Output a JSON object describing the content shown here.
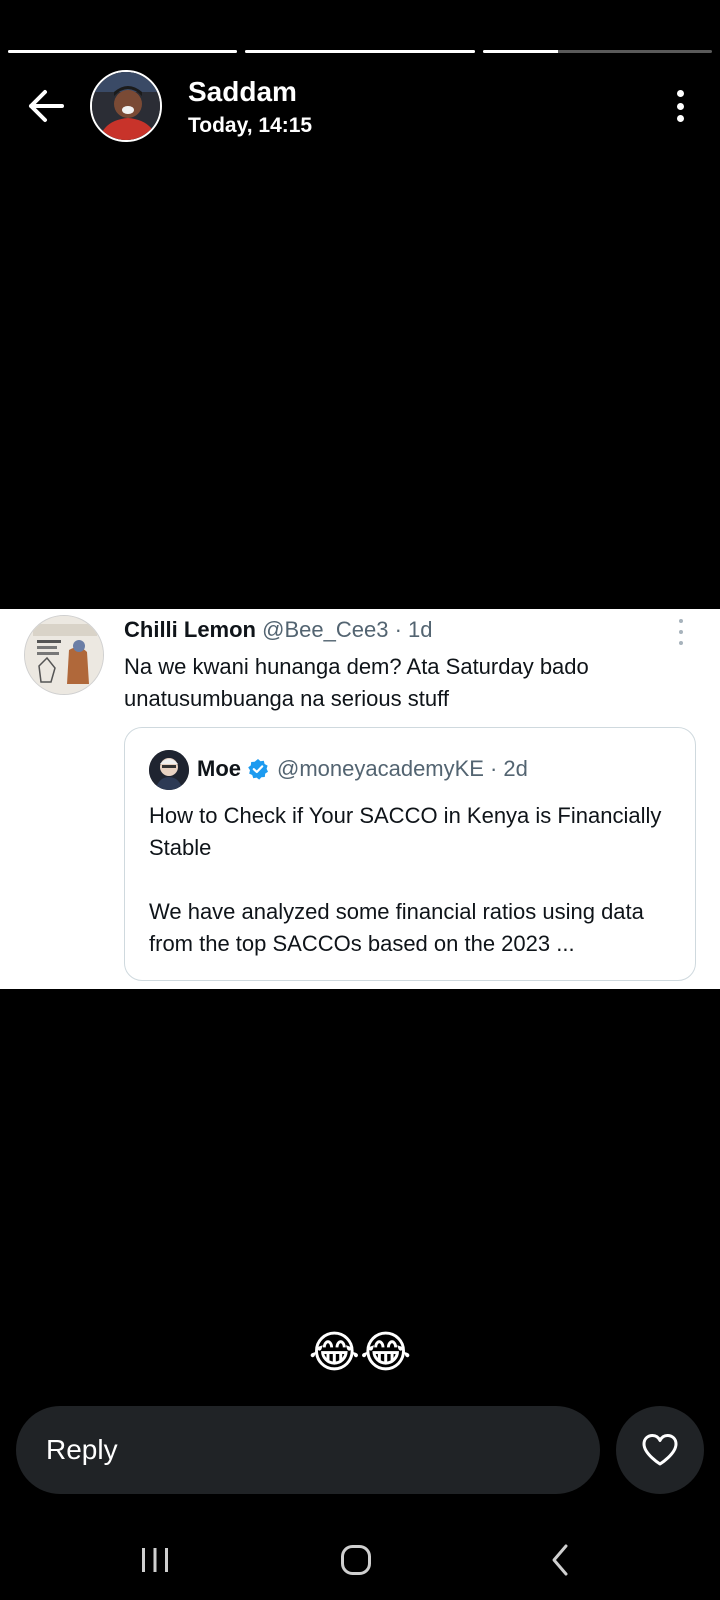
{
  "story": {
    "progress": [
      1.0,
      1.0,
      0.33
    ]
  },
  "header": {
    "user_name": "Saddam",
    "post_time": "Today, 14:15"
  },
  "tweet": {
    "author": "Chilli Lemon",
    "handle": "@Bee_Cee3",
    "age": "· 1d",
    "text": "Na we kwani hunanga dem? Ata Saturday bado unatusumbuanga na serious stuff",
    "quote": {
      "author": "Moe",
      "handle": "@moneyacademyKE",
      "age": "· 2d",
      "title": "How to Check if Your SACCO in Kenya is Financially Stable",
      "body": "We have analyzed some financial ratios using data from the top SACCOs based on the 2023 ..."
    }
  },
  "caption": "😂😂",
  "reply": {
    "placeholder": "Reply"
  },
  "colors": {
    "background": "#000000",
    "input_bg": "#202326",
    "handle_gray": "#536471",
    "verified_blue": "#1d9bf0"
  },
  "icons": {
    "back": "arrow-left-icon",
    "more": "more-vertical-icon",
    "like": "heart-icon",
    "verified": "verified-badge-icon",
    "nav_recents": "recents-icon",
    "nav_home": "home-icon",
    "nav_back": "chevron-left-icon"
  }
}
